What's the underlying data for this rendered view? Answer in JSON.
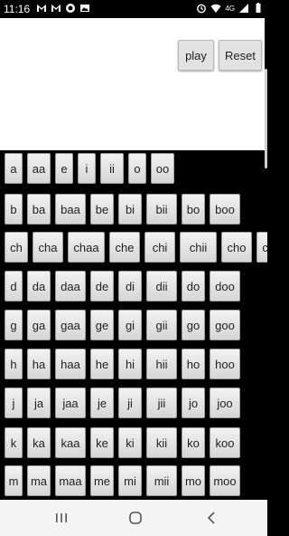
{
  "status_bar": {
    "time": "11:16",
    "left_icons": [
      "gmail-icon",
      "gmail-icon",
      "app-icon",
      "image-icon"
    ],
    "right_icons": [
      "alarm-icon",
      "wifi-icon",
      "signal-icon",
      "battery-icon"
    ],
    "network_label": "4G"
  },
  "controls": {
    "play_label": "play",
    "reset_label": "Reset"
  },
  "syllable_rows": [
    [
      "a",
      "aa",
      "e",
      "i",
      "ii",
      "o",
      "oo"
    ],
    [
      "b",
      "ba",
      "baa",
      "be",
      "bi",
      "bii",
      "bo",
      "boo"
    ],
    [
      "ch",
      "cha",
      "chaa",
      "che",
      "chi",
      "chii",
      "cho",
      "choo"
    ],
    [
      "d",
      "da",
      "daa",
      "de",
      "di",
      "dii",
      "do",
      "doo"
    ],
    [
      "g",
      "ga",
      "gaa",
      "ge",
      "gi",
      "gii",
      "go",
      "goo"
    ],
    [
      "h",
      "ha",
      "haa",
      "he",
      "hi",
      "hii",
      "ho",
      "hoo"
    ],
    [
      "j",
      "ja",
      "jaa",
      "je",
      "ji",
      "jii",
      "jo",
      "joo"
    ],
    [
      "k",
      "ka",
      "kaa",
      "ke",
      "ki",
      "kii",
      "ko",
      "koo"
    ],
    [
      "m",
      "ma",
      "maa",
      "me",
      "mi",
      "mii",
      "mo",
      "moo"
    ]
  ],
  "nav_bar": {
    "icons": [
      "recent-apps-icon",
      "home-icon",
      "back-icon"
    ]
  }
}
